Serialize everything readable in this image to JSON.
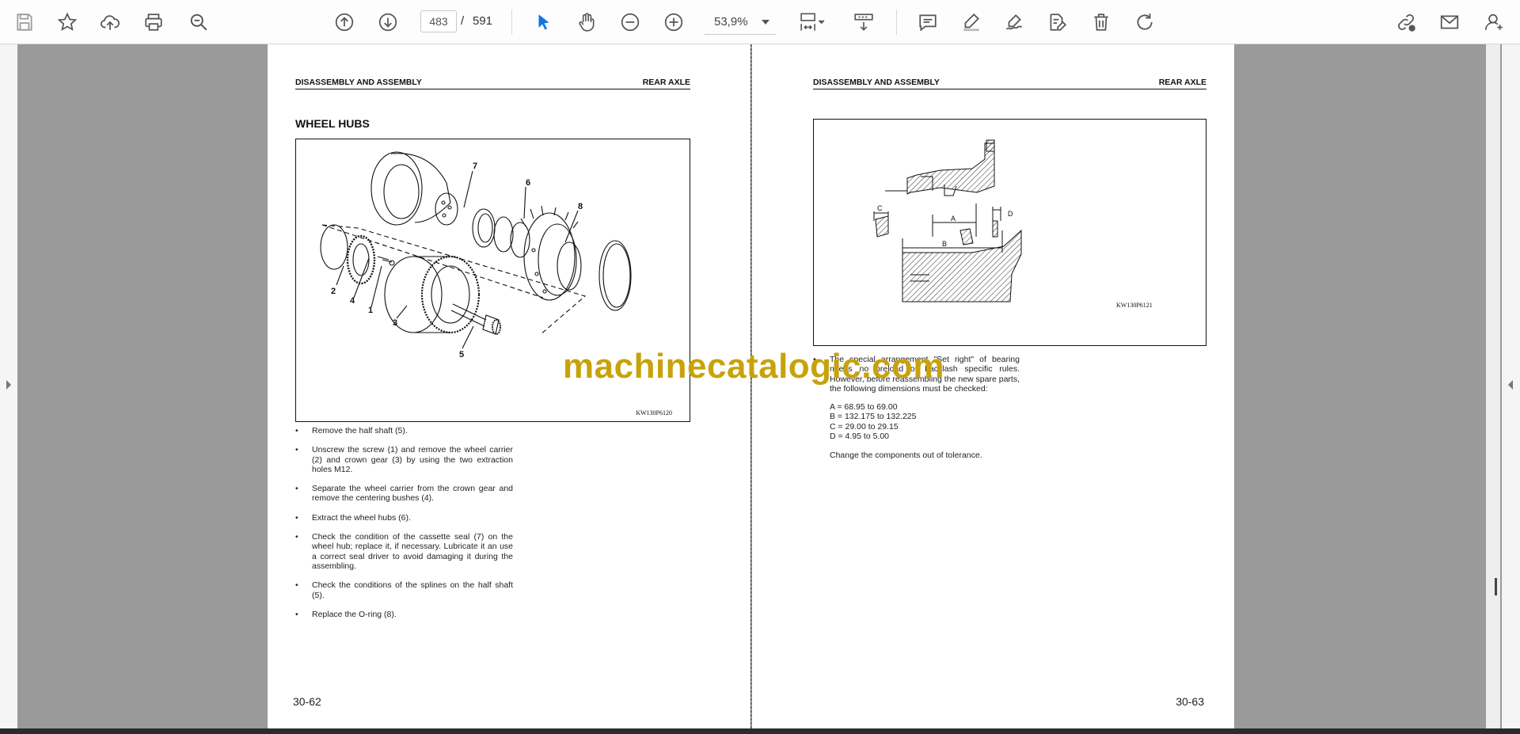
{
  "toolbar": {
    "page_current": "483",
    "page_separator": "/",
    "page_total": "591",
    "zoom": "53,9%",
    "icons": [
      "save-icon",
      "bookmark-star-icon",
      "upload-cloud-icon",
      "print-icon",
      "search-zoom-icon",
      "page-up-icon",
      "page-down-icon",
      "select-cursor-icon",
      "hand-pan-icon",
      "zoom-out-icon",
      "zoom-in-icon",
      "page-fit-icon",
      "scroll-mode-icon",
      "comment-icon",
      "highlight-pen-icon",
      "sign-icon",
      "edit-fill-icon",
      "delete-icon",
      "rotate-icon",
      "share-link-icon",
      "email-icon",
      "account-icon"
    ]
  },
  "colors": {
    "accent": "#1473e6",
    "watermark": "#c8a20a"
  },
  "left_page": {
    "header_left": "DISASSEMBLY AND ASSEMBLY",
    "header_right": "REAR AXLE",
    "title": "WHEEL HUBS",
    "figure_code": "KW130P6120",
    "figure_labels": [
      "7",
      "6",
      "8",
      "2",
      "4",
      "1",
      "3",
      "5"
    ],
    "steps": [
      "Remove the half shaft (5).",
      "Unscrew the screw (1) and remove the wheel carrier (2) and crown gear (3) by using the two extraction holes M12.",
      "Separate the wheel carrier from the crown gear and remove the centering bushes (4).",
      "Extract the wheel hubs (6).",
      "Check the condition of the cassette seal (7) on the wheel hub; replace it, if necessary. Lubricate it an use a correct seal driver to avoid damaging it during the assembling.",
      "Check the conditions of the splines on the half shaft (5).",
      "Replace the O-ring (8)."
    ],
    "page_number": "30-62"
  },
  "right_page": {
    "header_left": "DISASSEMBLY AND ASSEMBLY",
    "header_right": "REAR AXLE",
    "figure_code": "KW130P6121",
    "figure_labels": [
      "A",
      "B",
      "C",
      "D"
    ],
    "intro": "The special arrangement \"Set right\" of bearing needs no preload or backlash specific rules. However, before reassembling the new spare parts, the following dimensions must be checked:",
    "dimensions": [
      "A = 68.95 to 69.00",
      "B = 132.175 to 132.225",
      "C = 29.00 to 29.15",
      "D = 4.95 to 5.00"
    ],
    "note": "Change the components out of tolerance.",
    "page_number": "30-63"
  },
  "watermark": "machinecatalogic.com"
}
